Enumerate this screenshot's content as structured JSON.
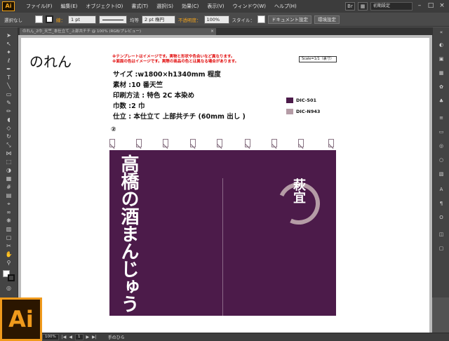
{
  "app": {
    "logo": "Ai",
    "badge": "Ai"
  },
  "menu": [
    "ファイル(F)",
    "編集(E)",
    "オブジェクト(O)",
    "書式(T)",
    "選択(S)",
    "効果(C)",
    "表示(V)",
    "ウィンドウ(W)",
    "ヘルプ(H)"
  ],
  "menubar_right": {
    "icon1": "Br",
    "workspace": "初期設定",
    "min": "–",
    "max": "□",
    "close": "×"
  },
  "controlbar": {
    "selection_label": "選択なし",
    "stroke_label": "線：",
    "stroke_weight": "1 pt",
    "line_style": "均等",
    "brush": "2 pt 楕円",
    "opacity_label": "不透明度：",
    "opacity_value": "100%",
    "style_label": "スタイル：",
    "doc_settings": "ドキュメント設定",
    "env_settings": "環境設定"
  },
  "tab": {
    "title": "のれん_2巾_天竺_本仕立て_上部共チチ @ 100% (RGB/プレビュー)",
    "close": "×"
  },
  "artboard": {
    "heading": "のれん",
    "warnings": [
      "※テンプレートはイメージです。実物と形状や色合いなど異なります。",
      "※面面の色はイメージです。実際の商品の色とは異なる場合があります。"
    ],
    "scale": "Scale=1/1（裏寸）",
    "specs": [
      "サイズ :w1800×h1340mm 程度",
      "素材 :10 番天竺",
      "印刷方法 : 特色 2C 本染め",
      "巾数 :2 巾",
      "仕立 : 本仕立て 上部共チチ (60mm 出し )"
    ],
    "legend": [
      {
        "label": "DIC-501",
        "color": "#4c1b4a"
      },
      {
        "label": "DIC-N943",
        "color": "#b59ca6"
      }
    ],
    "number_mark": "②",
    "noren": {
      "main_text": "高橋の酒まんじゅう",
      "logo_text": "萩宜"
    }
  },
  "status": {
    "zoom": "100%",
    "page": "1",
    "tool": "手のひら"
  },
  "colors": {
    "noren": "#4c1b4a",
    "accent": "#b59ca6",
    "ai_orange": "#f09a1c"
  }
}
